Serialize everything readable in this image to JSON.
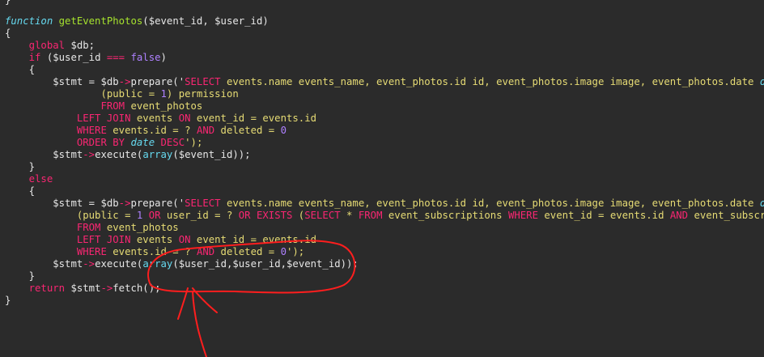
{
  "colors": {
    "background": "#2b2b2b",
    "keyword": "#f92672",
    "function_name": "#a6e22e",
    "string": "#e6db74",
    "storage": "#66d9ef",
    "annotation_red": "#ff1e1e"
  },
  "code": {
    "l0_brace": "}",
    "l1_kw": "function",
    "l1_name": "getEventPhotos",
    "l1_args": "($event_id, $user_id)",
    "l2": "{",
    "l3_kw": "global",
    "l3_rest": " $db;",
    "l4_kw": "if",
    "l4_a": " ($user_id ",
    "l4_op": "===",
    "l4_sp": " ",
    "l4_false": "false",
    "l4_b": ")",
    "l5": "{",
    "l6_a": "$stmt = $db",
    "l6_arrow": "->",
    "l6_b": "prepare('",
    "l6_sel": "SELECT",
    "l6_c": " events.name events_name, event_photos.id id, event_photos.image image, event_photos.date ",
    "l6_date": "date",
    "l6_d": ",",
    "l7_a": "(public = ",
    "l7_num": "1",
    "l7_b": ") permission",
    "l8_from": "FROM",
    "l8_b": " event_photos",
    "l9_join": "LEFT JOIN",
    "l9_b": " events ",
    "l9_on": "ON",
    "l9_c": " event_id = events.id",
    "l10_where": "WHERE",
    "l10_b": " events.id = ? ",
    "l10_and": "AND",
    "l10_c": " deleted = ",
    "l10_num": "0",
    "l11_order": "ORDER BY",
    "l11_sp": " ",
    "l11_date": "date",
    "l11_sp2": " ",
    "l11_desc": "DESC",
    "l11_end": "');",
    "l12_a": "$stmt",
    "l12_arrow": "->",
    "l12_b": "execute(",
    "l12_arr": "array",
    "l12_c": "($event_id));",
    "l13": "}",
    "l14_else": "else",
    "l15": "{",
    "l16_a": "$stmt = $db",
    "l16_arrow": "->",
    "l16_b": "prepare('",
    "l16_sel": "SELECT",
    "l16_c": " events.name events_name, event_photos.id id, event_photos.image image, event_photos.date ",
    "l16_date": "date",
    "l16_d": ",",
    "l17_a": "(public = ",
    "l17_num": "1",
    "l17_sp": " ",
    "l17_or": "OR",
    "l17_b": " user_id = ? ",
    "l17_or2": "OR",
    "l17_sp2": " ",
    "l17_exists": "EXISTS",
    "l17_c": " (",
    "l17_sel": "SELECT",
    "l17_d": " * ",
    "l17_from": "FROM",
    "l17_e": " event_subscriptions ",
    "l17_where": "WHERE",
    "l17_f": " event_id = events.id ",
    "l17_and": "AND",
    "l17_g": " event_subscriptions",
    "l18_from": "FROM",
    "l18_b": " event_photos",
    "l19_join": "LEFT JOIN",
    "l19_b": " events ",
    "l19_on": "ON",
    "l19_c": " event_id = events.id",
    "l20_where": "WHERE",
    "l20_b": " events.id = ? ",
    "l20_and": "AND",
    "l20_c": " deleted = ",
    "l20_num": "0",
    "l20_end": "');",
    "l21_a": "$stmt",
    "l21_arrow": "->",
    "l21_b": "execute(",
    "l21_arr": "array",
    "l21_c": "($user_id,$user_id,$event_id));",
    "l22": "}",
    "l23_kw": "return",
    "l23_a": " $stmt",
    "l23_arrow": "->",
    "l23_b": "fetch();",
    "l24": "}"
  }
}
